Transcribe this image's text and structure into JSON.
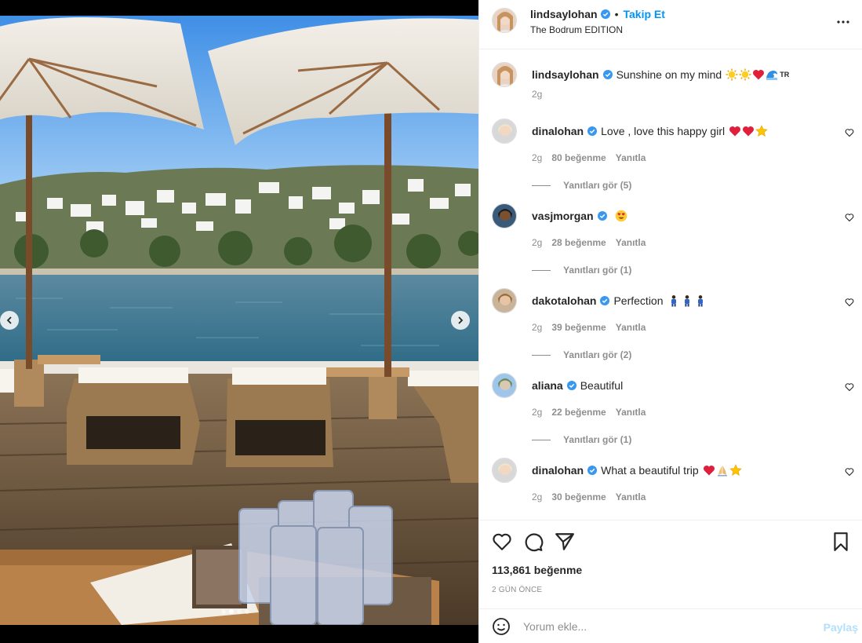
{
  "post": {
    "username": "lindsaylohan",
    "follow_label": "Takip Et",
    "location": "The Bodrum EDITION",
    "caption": {
      "username": "lindsaylohan",
      "text": "Sunshine on my mind",
      "emojis": [
        "sun",
        "sun",
        "heart",
        "wave"
      ],
      "trailing": "TR",
      "time": "2g"
    }
  },
  "comments": [
    {
      "username": "dinalohan",
      "text": "Love , love this happy girl",
      "emojis": [
        "heart",
        "heart",
        "star"
      ],
      "time": "2g",
      "likes": "80 beğenme",
      "reply": "Yanıtla",
      "view_replies": "Yanıtları gör (5)"
    },
    {
      "username": "vasjmorgan",
      "text": "",
      "emojis": [
        "heart-eyes"
      ],
      "time": "2g",
      "likes": "28 beğenme",
      "reply": "Yanıtla",
      "view_replies": "Yanıtları gör (1)"
    },
    {
      "username": "dakotalohan",
      "text": "Perfection",
      "emojis": [
        "person",
        "person",
        "person"
      ],
      "time": "2g",
      "likes": "39 beğenme",
      "reply": "Yanıtla",
      "view_replies": "Yanıtları gör (2)"
    },
    {
      "username": "aliana",
      "text": "Beautiful",
      "emojis": [],
      "time": "2g",
      "likes": "22 beğenme",
      "reply": "Yanıtla",
      "view_replies": "Yanıtları gör (1)"
    },
    {
      "username": "dinalohan",
      "text": "What a beautiful trip",
      "emojis": [
        "heart",
        "pray",
        "star"
      ],
      "time": "2g",
      "likes": "30 beğenme",
      "reply": "Yanıtla",
      "view_replies": "Yanıtları gör (1)"
    }
  ],
  "stats": {
    "likes": "113,861 beğenme",
    "date": "2 GÜN ÖNCE"
  },
  "compose": {
    "placeholder": "Yorum ekle...",
    "post_label": "Paylaş"
  },
  "carousel": {
    "slides": 4,
    "active": 2
  },
  "colors": {
    "accent": "#0095f6",
    "muted": "#8e8e8e",
    "text": "#262626",
    "verified": "#3897f0"
  }
}
